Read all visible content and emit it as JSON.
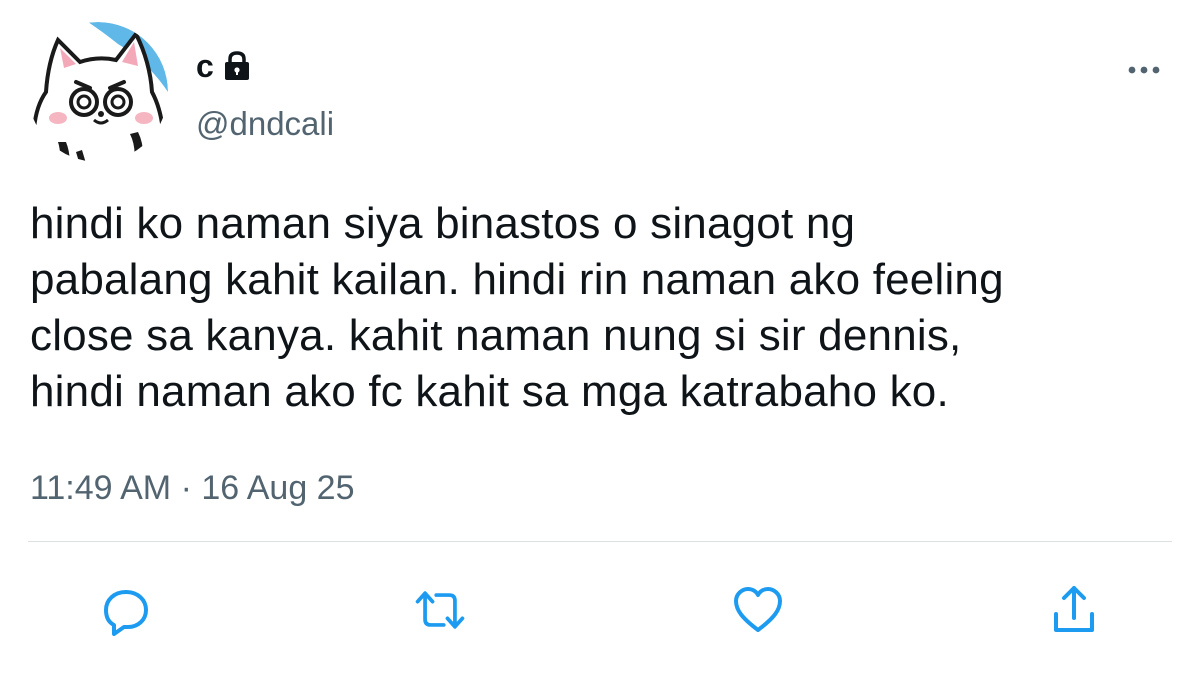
{
  "author": {
    "display_name": "c",
    "handle": "@dndcali",
    "protected": true,
    "avatar": "cat-avatar"
  },
  "tweet": {
    "text_lines": [
      "hindi ko naman siya binastos o sinagot ng",
      "pabalang kahit kailan. hindi rin naman ako feeling",
      "close sa kanya. kahit naman nung si sir dennis,",
      "hindi naman ako fc kahit sa mga katrabaho ko."
    ],
    "timestamp": "11:49 AM · 16 Aug 25"
  },
  "actions": [
    {
      "name": "reply",
      "icon": "reply-icon"
    },
    {
      "name": "retweet",
      "icon": "retweet-icon"
    },
    {
      "name": "like",
      "icon": "heart-icon"
    },
    {
      "name": "share",
      "icon": "share-icon"
    }
  ],
  "colors": {
    "text": "#0f1419",
    "secondary": "#536471",
    "icon": "#1d9bf0",
    "divider": "#dcdfe3",
    "avatar_bg": "#5fb8e8"
  }
}
